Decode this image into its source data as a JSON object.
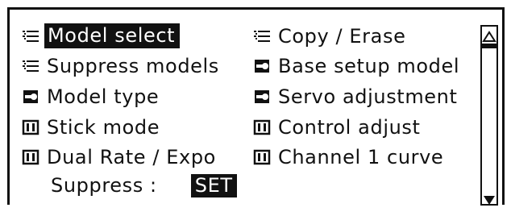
{
  "menu": {
    "left": [
      {
        "icon": "list-icon",
        "label": "Model select",
        "selected": true
      },
      {
        "icon": "list-icon",
        "label": "Suppress models",
        "selected": false
      },
      {
        "icon": "airplane-model-icon",
        "label": "Model type",
        "selected": false
      },
      {
        "icon": "transmitter-icon",
        "label": "Stick mode",
        "selected": false
      },
      {
        "icon": "transmitter-icon",
        "label": "Dual Rate / Expo",
        "selected": false
      }
    ],
    "right": [
      {
        "icon": "list-icon",
        "label": "Copy / Erase",
        "selected": false
      },
      {
        "icon": "airplane-model-icon",
        "label": "Base setup model",
        "selected": false
      },
      {
        "icon": "airplane-model-icon",
        "label": "Servo adjustment",
        "selected": false
      },
      {
        "icon": "transmitter-icon",
        "label": "Control adjust",
        "selected": false
      },
      {
        "icon": "transmitter-icon",
        "label": "Channel 1 curve",
        "selected": false
      }
    ]
  },
  "suppress": {
    "label": "Suppress :",
    "value": "SET"
  },
  "scrollbar": {
    "up_icon": "triangle-up-icon",
    "down_icon": "triangle-down-icon",
    "position": 0.0
  },
  "colors": {
    "foreground": "#111111",
    "background": "#ffffff"
  }
}
